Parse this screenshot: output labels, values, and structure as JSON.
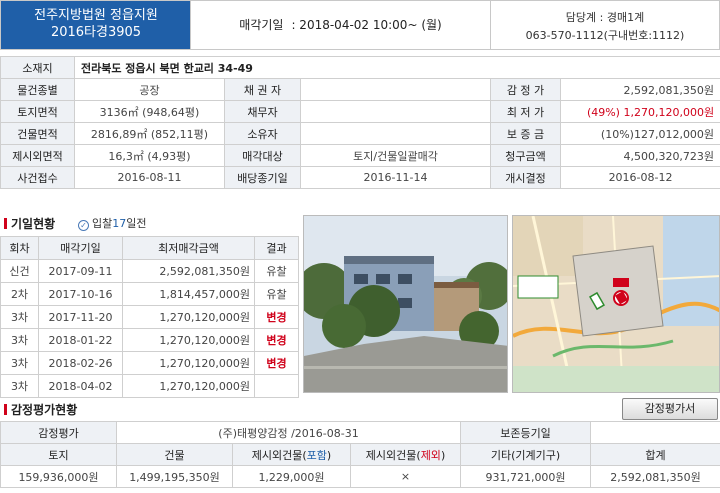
{
  "header": {
    "court_name": "전주지방법원 정읍지원",
    "case_no": "2016타경3905",
    "auction_date_label": "매각기일",
    "auction_date": ": 2018-04-02  10:00~ (월)",
    "dept": "담당계 : 경매1계",
    "phone": "063-570-1112(구내번호:1112)"
  },
  "info": {
    "location_label": "소재지",
    "location": "전라북도 정읍시 북면 한교리 34-49",
    "item_type_label": "물건종별",
    "item_type": "공장",
    "creditor_label": "채 권 자",
    "creditor": "",
    "appraisal_label": "감 정 가",
    "appraisal": "2,592,081,350원",
    "land_area_label": "토지면적",
    "land_area": "3136㎡ (948,64평)",
    "debtor_label": "채무자",
    "debtor": "",
    "min_price_label": "최 저 가",
    "min_price": "(49%) 1,270,120,000원",
    "building_area_label": "건물면적",
    "building_area": "2816,89㎡ (852,11평)",
    "owner_label": "소유자",
    "owner": "",
    "deposit_label": "보 증 금",
    "deposit": "(10%)127,012,000원",
    "excluded_area_label": "제시외면적",
    "excluded_area": "16,3㎡ (4,93평)",
    "sale_target_label": "매각대상",
    "sale_target": "토지/건물일괄매각",
    "claim_label": "청구금액",
    "claim": "4,500,320,723원",
    "case_received_label": "사건접수",
    "case_received": "2016-08-11",
    "dividend_label": "배당종기일",
    "dividend_date": "2016-11-14",
    "start_label": "개시결정",
    "start_date": "2016-08-12"
  },
  "history": {
    "title": "기일현황",
    "bid_prefix": "입찰",
    "bid_days": "17",
    "bid_suffix": "일전",
    "columns": [
      "회차",
      "매각기일",
      "최저매각금액",
      "결과"
    ],
    "rows": [
      {
        "round": "신건",
        "date": "2017-09-11",
        "price": "2,592,081,350원",
        "result": "유찰",
        "red": false
      },
      {
        "round": "2차",
        "date": "2017-10-16",
        "price": "1,814,457,000원",
        "result": "유찰",
        "red": false
      },
      {
        "round": "3차",
        "date": "2017-11-20",
        "price": "1,270,120,000원",
        "result": "변경",
        "red": true
      },
      {
        "round": "3차",
        "date": "2018-01-22",
        "price": "1,270,120,000원",
        "result": "변경",
        "red": true
      },
      {
        "round": "3차",
        "date": "2018-02-26",
        "price": "1,270,120,000원",
        "result": "변경",
        "red": true
      },
      {
        "round": "3차",
        "date": "2018-04-02",
        "price": "1,270,120,000원",
        "result": "",
        "red": false
      }
    ]
  },
  "map": {
    "marker_label": "소재지",
    "note": "토지/건물일괄매각"
  },
  "appraisal_section": {
    "title": "감정평가현황",
    "button": "감정평가서",
    "appraisal_label": "감정평가",
    "appraiser": "(주)태평양감정 /2016-08-31",
    "registry_label": "보존등기일",
    "registry_date": "",
    "columns": [
      "토지",
      "건물",
      "제시외건물(",
      "포함",
      ")",
      "제시외건물(",
      "제외",
      ")",
      "기타(기계기구)",
      "합계"
    ],
    "values": [
      "159,936,000원",
      "1,499,195,350원",
      "1,229,000원",
      "×",
      "931,721,000원",
      "2,592,081,350원"
    ]
  },
  "colors": {
    "brand_blue": "#1f5fa8",
    "alert_red": "#d0021b",
    "header_bg": "#eef1f5"
  }
}
